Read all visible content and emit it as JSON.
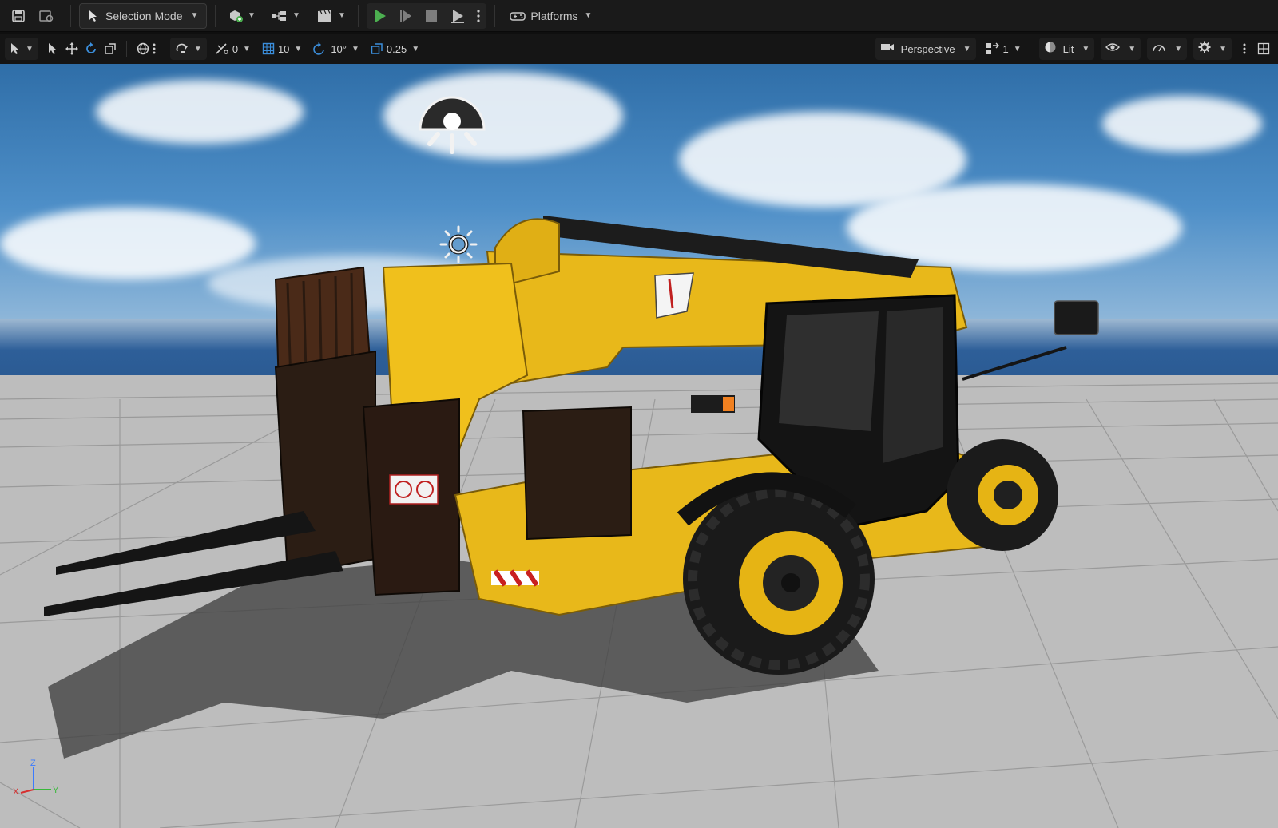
{
  "toolbar": {
    "selection_mode_label": "Selection Mode",
    "platforms_label": "Platforms"
  },
  "viewport_toolbar": {
    "rotation_snap": "0",
    "grid_snap": "10",
    "angle_snap": "10°",
    "scale_snap": "0.25",
    "view_mode": "Perspective",
    "camera_speed": "1",
    "lit_mode": "Lit"
  },
  "axes": {
    "x_label": "X",
    "y_label": "Y",
    "z_label": "Z"
  },
  "colors": {
    "play_green": "#4caf50",
    "accent_blue": "#3b8edb",
    "machine_yellow": "#f2c11a"
  }
}
